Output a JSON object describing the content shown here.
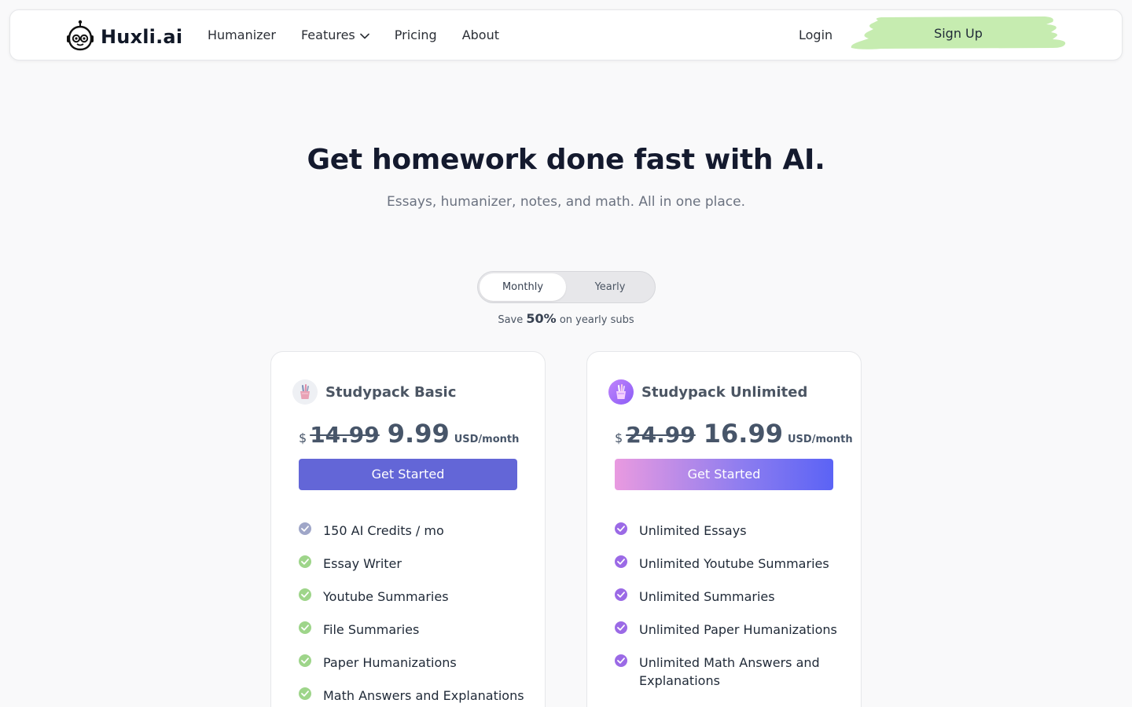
{
  "nav": {
    "brand": "Huxli.ai",
    "links": [
      {
        "label": "Humanizer"
      },
      {
        "label": "Features"
      },
      {
        "label": "Pricing"
      },
      {
        "label": "About"
      }
    ],
    "login": "Login",
    "signup": "Sign Up",
    "signup_highlight_color": "#c6ecb0"
  },
  "hero": {
    "title": "Get homework done fast with AI.",
    "subtitle": "Essays, humanizer, notes, and math. All in one place."
  },
  "billing": {
    "monthly": "Monthly",
    "yearly": "Yearly",
    "selected": "Monthly",
    "save_prefix": "Save",
    "save_percent": "50%",
    "save_suffix": "on yearly subs"
  },
  "plans": [
    {
      "name": "Studypack Basic",
      "currency": "$",
      "old_price": "14.99",
      "price": "9.99",
      "per": "USD/month",
      "cta": "Get Started",
      "cta_color": "#6366d7",
      "features": [
        {
          "label": "150 AI Credits / mo",
          "check_color": "#9fa6c8"
        },
        {
          "label": "Essay Writer",
          "check_color": "#9ed58a"
        },
        {
          "label": "Youtube Summaries",
          "check_color": "#9ed58a"
        },
        {
          "label": "File Summaries",
          "check_color": "#9ed58a"
        },
        {
          "label": "Paper Humanizations",
          "check_color": "#9ed58a"
        },
        {
          "label": "Math Answers and Explanations",
          "check_color": "#9ed58a"
        }
      ]
    },
    {
      "name": "Studypack Unlimited",
      "currency": "$",
      "old_price": "24.99",
      "price": "16.99",
      "per": "USD/month",
      "cta": "Get Started",
      "features": [
        {
          "label": "Unlimited Essays",
          "check_color": "#9b6ae6"
        },
        {
          "label": "Unlimited Youtube Summaries",
          "check_color": "#9b6ae6"
        },
        {
          "label": "Unlimited Summaries",
          "check_color": "#9b6ae6"
        },
        {
          "label": "Unlimited Paper Humanizations",
          "check_color": "#9b6ae6"
        },
        {
          "label": "Unlimited Math Answers and Explanations",
          "check_color": "#9b6ae6"
        }
      ]
    }
  ]
}
